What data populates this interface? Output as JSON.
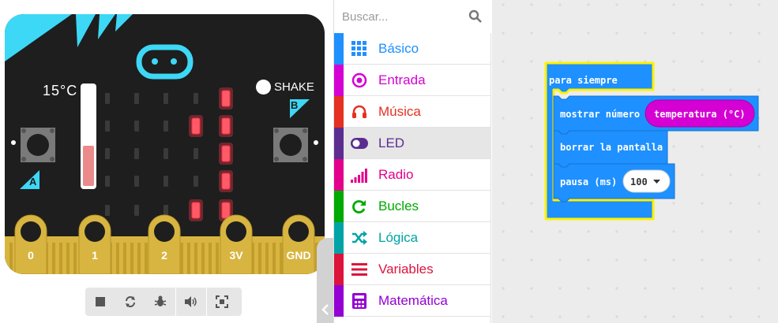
{
  "simulator": {
    "temperature": "15°C",
    "temperature_level": 0.4,
    "shake_label": "SHAKE",
    "button_a": "A",
    "button_b": "B",
    "pins": [
      "0",
      "1",
      "2",
      "3V",
      "GND"
    ],
    "led_grid_on": [
      [
        false,
        false,
        false,
        false,
        true
      ],
      [
        false,
        false,
        false,
        true,
        true
      ],
      [
        false,
        false,
        false,
        false,
        true
      ],
      [
        false,
        false,
        false,
        false,
        true
      ],
      [
        false,
        false,
        false,
        true,
        true
      ]
    ],
    "colors": {
      "board": "#1e1e1e",
      "accent": "#3dd8f5",
      "gold": "#d8b540",
      "led_on": "#ff3b4d",
      "led_off": "#3a3a3a"
    },
    "toolbar": [
      "stop-icon",
      "restart-icon",
      "debug-icon",
      "sound-icon",
      "fullscreen-icon"
    ]
  },
  "toolbox": {
    "search_placeholder": "Buscar...",
    "categories": [
      {
        "label": "Básico",
        "color": "#1e90ff",
        "icon": "grid-icon"
      },
      {
        "label": "Entrada",
        "color": "#d400d4",
        "icon": "target-icon"
      },
      {
        "label": "Música",
        "color": "#e63022",
        "icon": "headphones-icon"
      },
      {
        "label": "LED",
        "color": "#5c2d91",
        "icon": "toggle-icon"
      },
      {
        "label": "Radio",
        "color": "#e3008c",
        "icon": "signal-icon"
      },
      {
        "label": "Bucles",
        "color": "#00aa00",
        "icon": "refresh-icon"
      },
      {
        "label": "Lógica",
        "color": "#00a4a6",
        "icon": "shuffle-icon"
      },
      {
        "label": "Variables",
        "color": "#dc143c",
        "icon": "list-icon"
      },
      {
        "label": "Matemática",
        "color": "#9400d3",
        "icon": "calculator-icon"
      }
    ],
    "selected": "LED"
  },
  "workspace": {
    "forever_label": "para siempre",
    "show_number_label": "mostrar número",
    "temperature_reporter": "temperatura (°C)",
    "clear_screen_label": "borrar la pantalla",
    "pause_label": "pausa (ms)",
    "pause_value": "100",
    "colors": {
      "basic": "#1e90ff",
      "input": "#d400d4",
      "outline": "#fff200"
    }
  }
}
